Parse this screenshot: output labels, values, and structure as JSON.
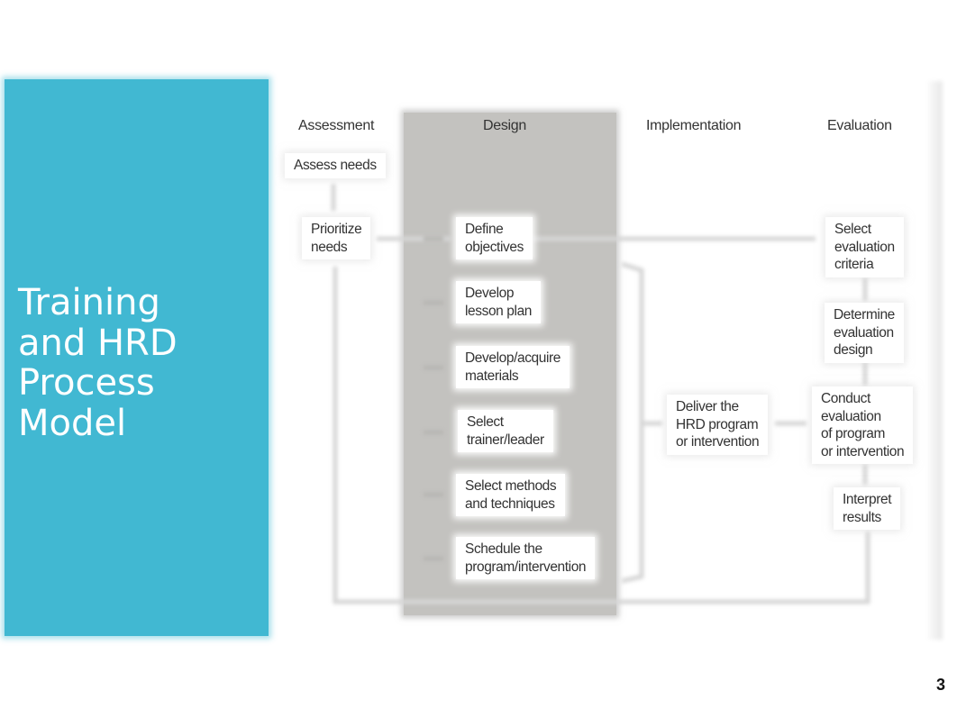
{
  "slide": {
    "title_lines": [
      "Training",
      "and HRD",
      "Process",
      "Model"
    ],
    "slide_number": "3",
    "accent_color": "#41B8D2",
    "design_panel_color": "#C3C2BF"
  },
  "diagram": {
    "phases": [
      {
        "label": "Assessment"
      },
      {
        "label": "Design"
      },
      {
        "label": "Implementation"
      },
      {
        "label": "Evaluation"
      }
    ],
    "assessment_steps": [
      {
        "lines": [
          "Assess needs"
        ]
      },
      {
        "lines": [
          "Prioritize",
          "needs"
        ]
      }
    ],
    "design_steps": [
      {
        "lines": [
          "Define",
          "objectives"
        ]
      },
      {
        "lines": [
          "Develop",
          "lesson plan"
        ]
      },
      {
        "lines": [
          "Develop/acquire",
          "materials"
        ]
      },
      {
        "lines": [
          "Select",
          "trainer/leader"
        ]
      },
      {
        "lines": [
          "Select methods",
          "and techniques"
        ]
      },
      {
        "lines": [
          "Schedule the",
          "program/intervention"
        ]
      }
    ],
    "implementation_steps": [
      {
        "lines": [
          "Deliver the",
          "HRD program",
          "or intervention"
        ]
      }
    ],
    "evaluation_steps": [
      {
        "lines": [
          "Select",
          "evaluation",
          "criteria"
        ]
      },
      {
        "lines": [
          "Determine",
          "evaluation",
          "design"
        ]
      },
      {
        "lines": [
          "Conduct",
          "evaluation",
          "of program",
          "or intervention"
        ]
      },
      {
        "lines": [
          "Interpret",
          "results"
        ]
      }
    ]
  }
}
